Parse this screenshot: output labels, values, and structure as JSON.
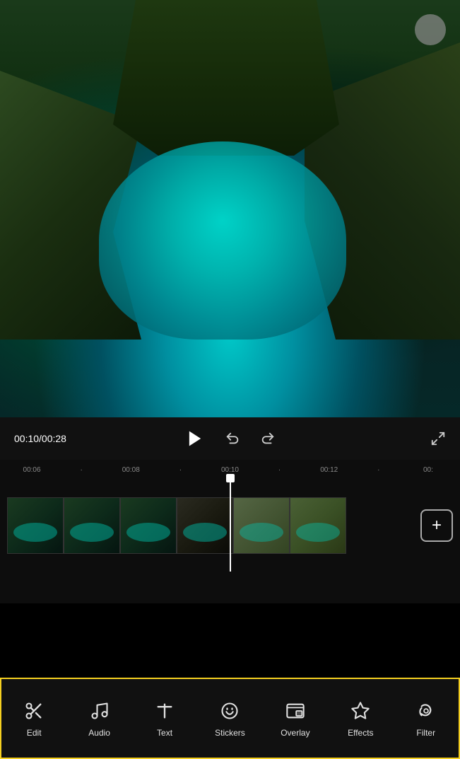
{
  "video": {
    "current_time": "00:10",
    "total_time": "00:28",
    "time_display": "00:10/00:28"
  },
  "timeline": {
    "ruler_marks": [
      "00:06",
      "",
      "00:08",
      "",
      "00:10",
      "",
      "00:12",
      "",
      "00:"
    ]
  },
  "toolbar": {
    "items": [
      {
        "id": "edit",
        "label": "Edit",
        "icon": "scissors"
      },
      {
        "id": "audio",
        "label": "Audio",
        "icon": "music-note"
      },
      {
        "id": "text",
        "label": "Text",
        "icon": "text-t"
      },
      {
        "id": "stickers",
        "label": "Stickers",
        "icon": "sticker"
      },
      {
        "id": "overlay",
        "label": "Overlay",
        "icon": "overlay-box"
      },
      {
        "id": "effects",
        "label": "Effects",
        "icon": "star"
      },
      {
        "id": "filter",
        "label": "Filter",
        "icon": "filter-swirl"
      }
    ]
  },
  "controls": {
    "play_label": "▶",
    "undo_label": "↺",
    "redo_label": "↻",
    "fullscreen_label": "⛶",
    "add_label": "+"
  }
}
